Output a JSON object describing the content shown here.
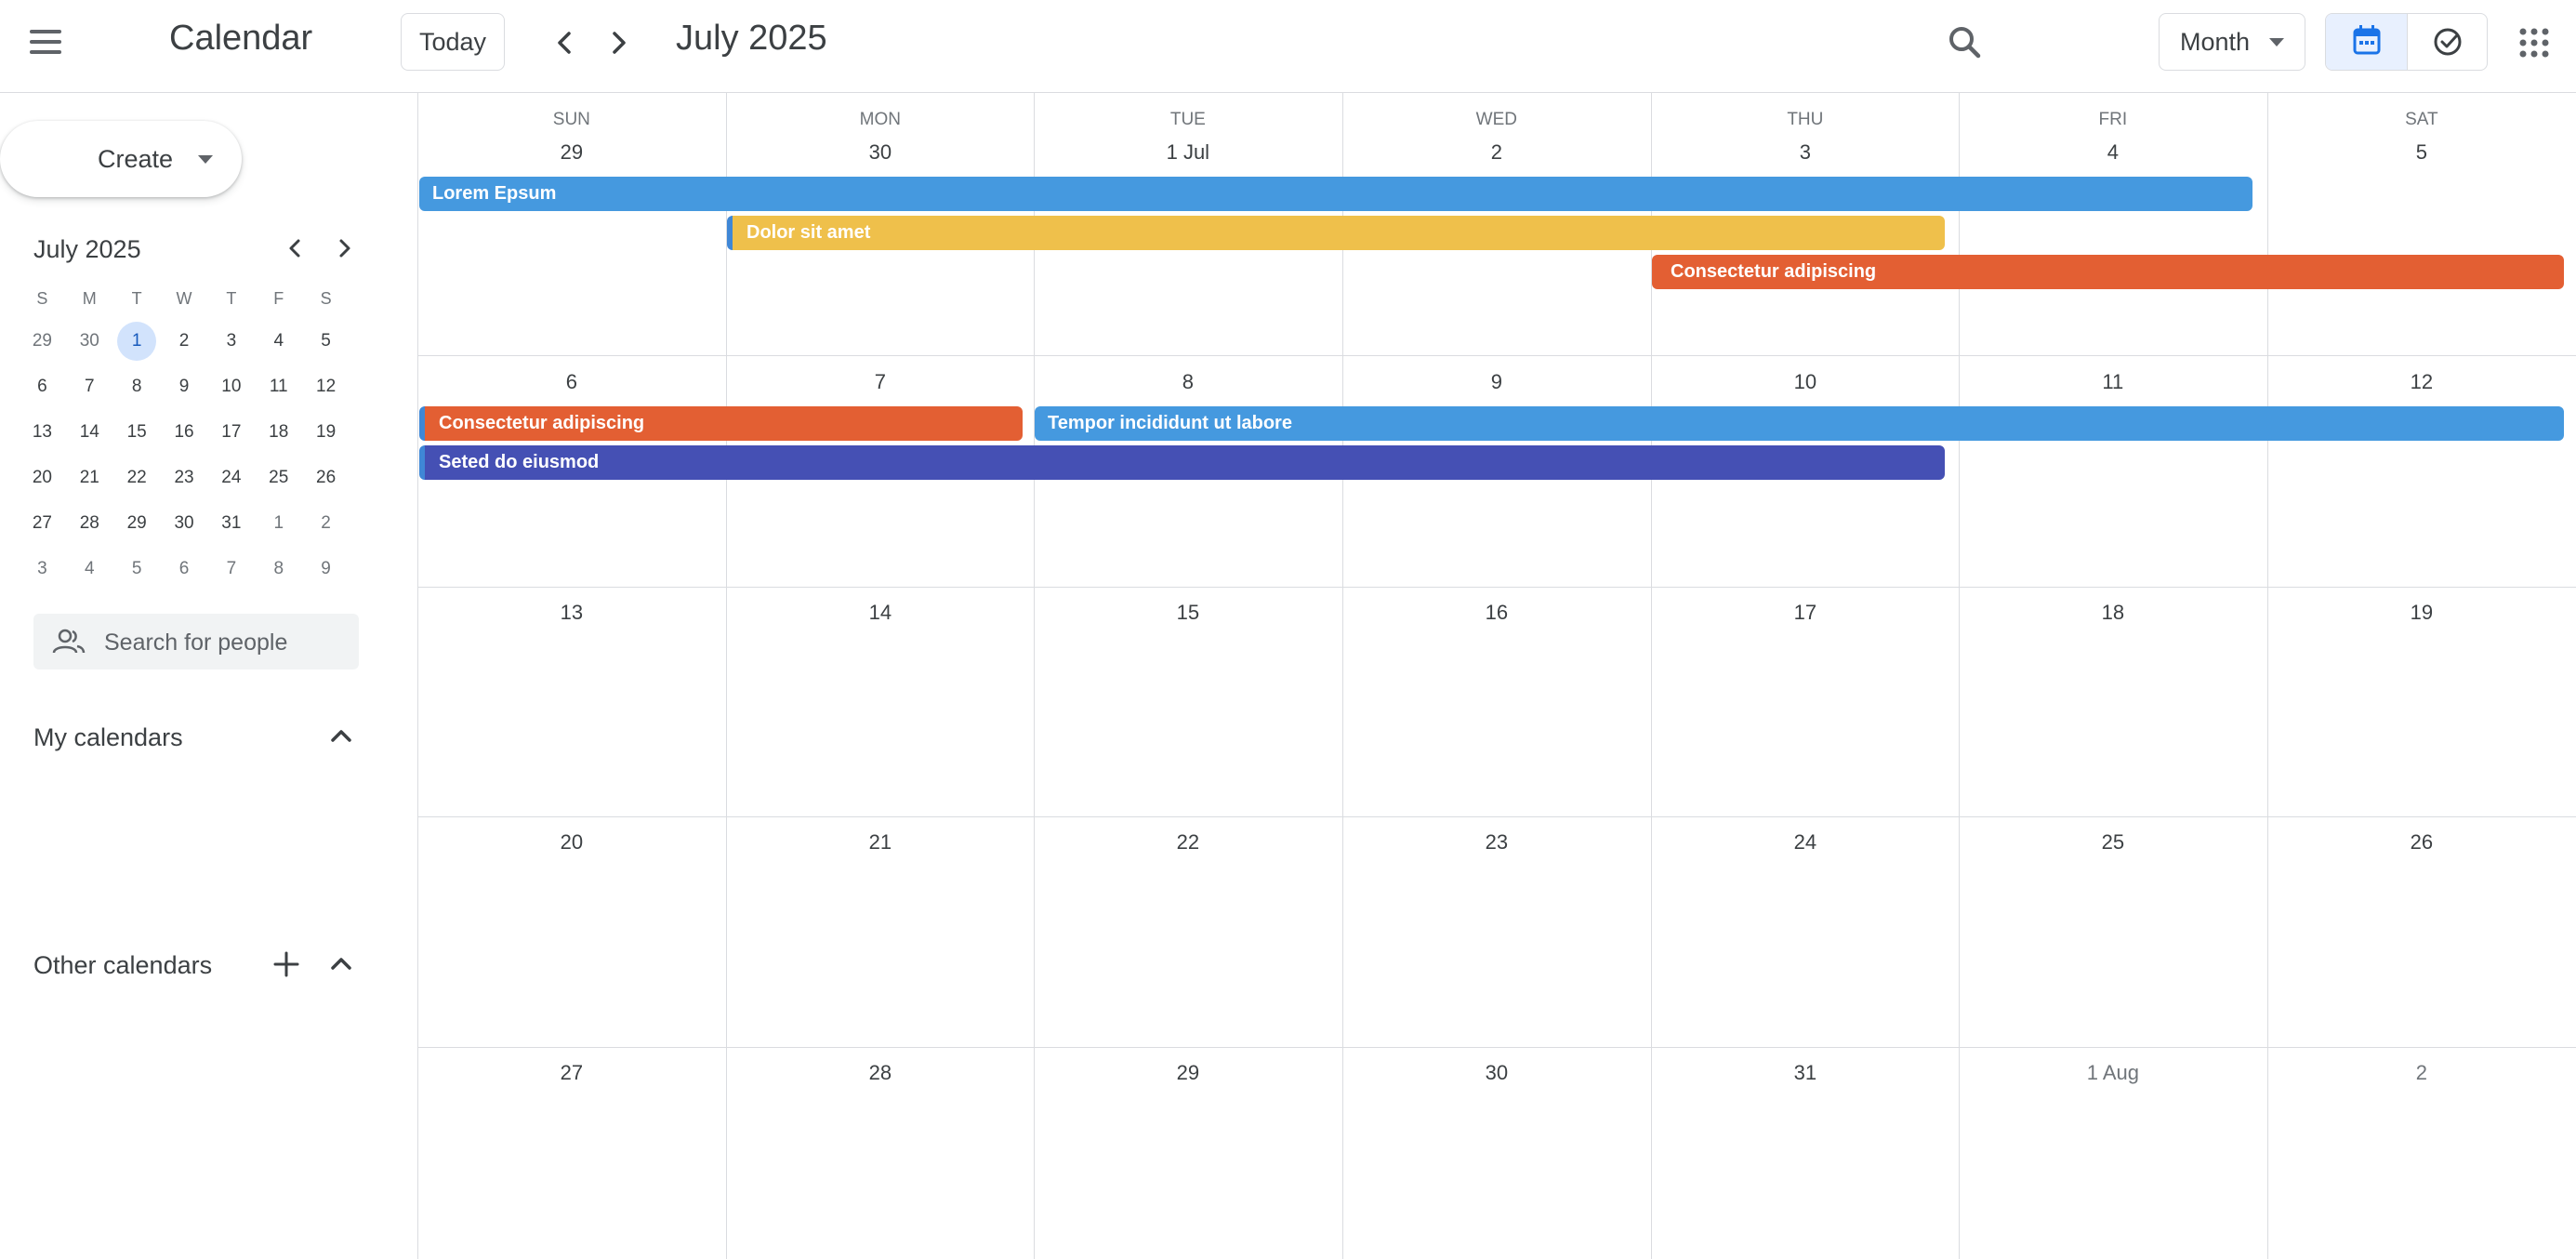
{
  "header": {
    "app_title": "Calendar",
    "today_label": "Today",
    "month_title": "July 2025",
    "view_label": "Month"
  },
  "sidebar": {
    "create_label": "Create",
    "mini_calendar": {
      "title": "July 2025",
      "weekday_headers": [
        "S",
        "M",
        "T",
        "W",
        "T",
        "F",
        "S"
      ],
      "weeks": [
        [
          "29",
          "30",
          "1",
          "2",
          "3",
          "4",
          "5"
        ],
        [
          "6",
          "7",
          "8",
          "9",
          "10",
          "11",
          "12"
        ],
        [
          "13",
          "14",
          "15",
          "16",
          "17",
          "18",
          "19"
        ],
        [
          "20",
          "21",
          "22",
          "23",
          "24",
          "25",
          "26"
        ],
        [
          "27",
          "28",
          "29",
          "30",
          "31",
          "1",
          "2"
        ],
        [
          "3",
          "4",
          "5",
          "6",
          "7",
          "8",
          "9"
        ]
      ]
    },
    "people_search_placeholder": "Search for people",
    "my_calendars_label": "My calendars",
    "other_calendars_label": "Other calendars"
  },
  "month_grid": {
    "weekday_headers": [
      "SUN",
      "MON",
      "TUE",
      "WED",
      "THU",
      "FRI",
      "SAT"
    ],
    "weeks": [
      [
        "29",
        "30",
        "1 Jul",
        "2",
        "3",
        "4",
        "5"
      ],
      [
        "6",
        "7",
        "8",
        "9",
        "10",
        "11",
        "12"
      ],
      [
        "13",
        "14",
        "15",
        "16",
        "17",
        "18",
        "19"
      ],
      [
        "20",
        "21",
        "22",
        "23",
        "24",
        "25",
        "26"
      ],
      [
        "27",
        "28",
        "29",
        "30",
        "31",
        "1 Aug",
        "2"
      ]
    ],
    "events": [
      {
        "title": "Lorem Epsum",
        "color": "#4599df"
      },
      {
        "title": "Dolor sit amet",
        "color": "#efc04b"
      },
      {
        "title": "Consectetur adipiscing",
        "color": "#e35f33"
      },
      {
        "title": "Consectetur adipiscing",
        "color": "#e35f33"
      },
      {
        "title": "Tempor incididunt ut labore",
        "color": "#4599df"
      },
      {
        "title": "Seted do eiusmod",
        "color": "#4550b4"
      }
    ]
  },
  "colors": {
    "accent": "#1a73e8",
    "selected_day_bg": "#d2e3fc",
    "grid_line": "#dadce0"
  }
}
